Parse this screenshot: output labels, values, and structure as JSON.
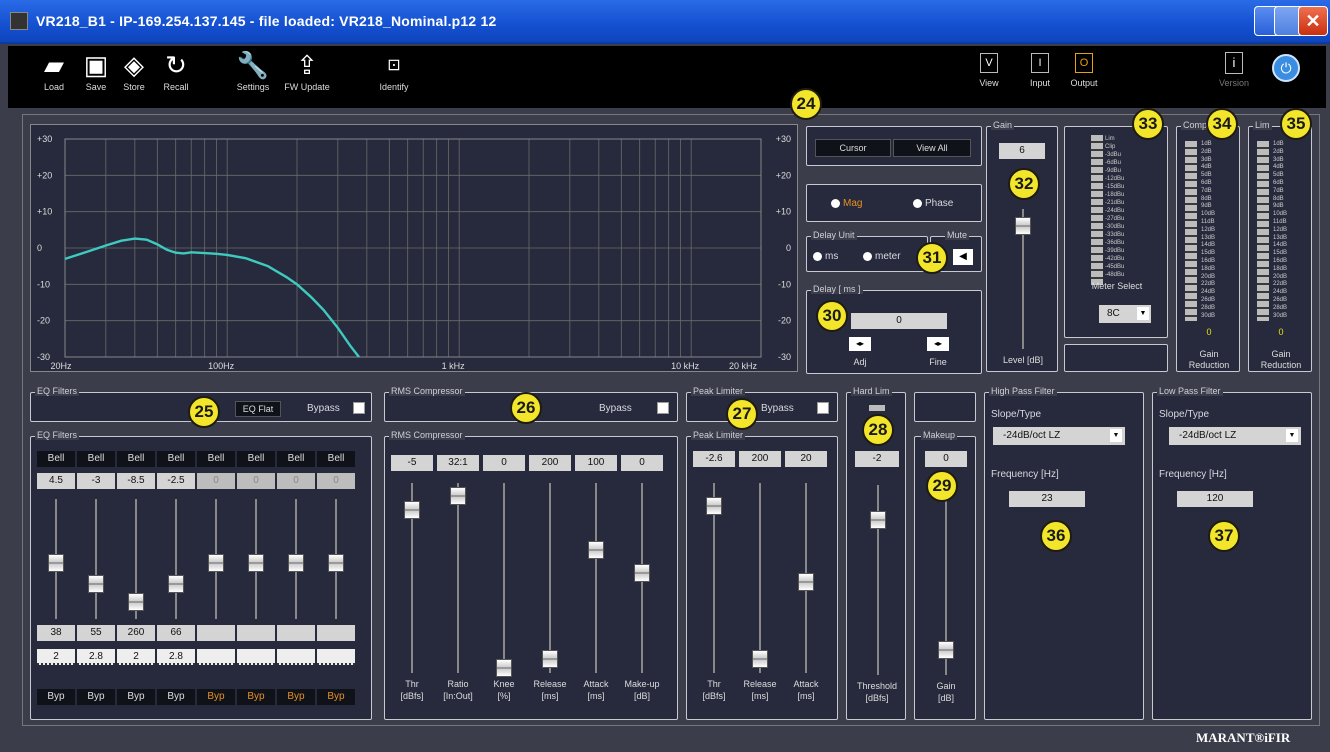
{
  "window": {
    "title": "VR218_B1 - IP-169.254.137.145 - file loaded: VR218_Nominal.p12 12"
  },
  "toolbar": {
    "left": [
      {
        "label": "Load",
        "icon": "folder-icon"
      },
      {
        "label": "Save",
        "icon": "floppy-icon"
      },
      {
        "label": "Store",
        "icon": "chip-icon"
      },
      {
        "label": "Recall",
        "icon": "refresh-icon"
      },
      {
        "label": "Settings",
        "icon": "wrench-icon"
      },
      {
        "label": "FW Update",
        "icon": "upload-icon"
      },
      {
        "label": "Identify",
        "icon": "magnifier-icon"
      }
    ],
    "view": {
      "label": "View",
      "value": "V"
    },
    "input": {
      "label": "Input",
      "value": "I"
    },
    "output": {
      "label": "Output",
      "value": "O"
    },
    "version": {
      "label": "Version",
      "value": "i"
    }
  },
  "plot": {
    "y_ticks": [
      "+30",
      "+20",
      "+10",
      "0",
      "-10",
      "-20",
      "-30"
    ],
    "x_ticks": [
      "20Hz",
      "100Hz",
      "1 kHz",
      "10 kHz",
      "20 kHz"
    ]
  },
  "cursor": {
    "cursor_label": "Cursor",
    "view_all_label": "View All"
  },
  "magphase": {
    "mag_label": "Mag",
    "phase_label": "Phase"
  },
  "delay_unit": {
    "title": "Delay Unit",
    "ms_label": "ms",
    "meter_label": "meter"
  },
  "mute": {
    "title": "Mute"
  },
  "delay": {
    "title": "Delay [ ms ]",
    "value": "0",
    "adj_label": "Adj",
    "fine_label": "Fine"
  },
  "gain": {
    "title": "Gain",
    "value": "6",
    "caption": "Level [dB]"
  },
  "meter": {
    "select_label": "Meter Select",
    "select_value": "8C",
    "labels": [
      "Lim",
      "Clip",
      "-3dBu",
      "-6dBu",
      "-9dBu",
      "-12dBu",
      "-15dBu",
      "-18dBu",
      "-21dBu",
      "-24dBu",
      "-27dBu",
      "-30dBu",
      "-33dBu",
      "-36dBu",
      "-39dBu",
      "-42dBu",
      "-45dBu",
      "-48dBu"
    ]
  },
  "comp_meter": {
    "title": "Comp",
    "value": "0",
    "caption1": "Gain",
    "caption2": "Reduction",
    "labels": [
      "1dB",
      "2dB",
      "3dB",
      "4dB",
      "5dB",
      "6dB",
      "7dB",
      "8dB",
      "9dB",
      "10dB",
      "11dB",
      "12dB",
      "13dB",
      "14dB",
      "15dB",
      "16dB",
      "18dB",
      "20dB",
      "22dB",
      "24dB",
      "26dB",
      "28dB",
      "30dB"
    ]
  },
  "lim_meter": {
    "title": "Lim",
    "value": "0",
    "caption1": "Gain",
    "caption2": "Reduction",
    "labels": [
      "1dB",
      "2dB",
      "3dB",
      "4dB",
      "5dB",
      "6dB",
      "7dB",
      "8dB",
      "9dB",
      "10dB",
      "11dB",
      "12dB",
      "13dB",
      "14dB",
      "15dB",
      "16dB",
      "18dB",
      "20dB",
      "22dB",
      "24dB",
      "26dB",
      "28dB",
      "30dB"
    ]
  },
  "eq_top": {
    "title": "EQ Filters",
    "flat_label": "EQ Flat",
    "bypass_label": "Bypass"
  },
  "rms_top": {
    "title": "RMS Compressor",
    "bypass_label": "Bypass"
  },
  "peak_top": {
    "title": "Peak Limiter",
    "bypass_label": "Bypass"
  },
  "hardlim": {
    "title": "Hard Lim",
    "value": "-2",
    "caption1": "Threshold",
    "caption2": "[dBfs]"
  },
  "eq": {
    "title": "EQ Filters",
    "types": [
      "Bell",
      "Bell",
      "Bell",
      "Bell",
      "Bell",
      "Bell",
      "Bell",
      "Bell"
    ],
    "gains": [
      "4.5",
      "-3",
      "-8.5",
      "-2.5",
      "0",
      "0",
      "0",
      "0"
    ],
    "freqs": [
      "38",
      "55",
      "260",
      "66",
      "",
      "",
      "",
      ""
    ],
    "qs": [
      "2",
      "2.8",
      "2",
      "2.8",
      "",
      "",
      "",
      ""
    ],
    "byp": [
      "Byp",
      "Byp",
      "Byp",
      "Byp",
      "Byp",
      "Byp",
      "Byp",
      "Byp"
    ],
    "byp_active": [
      false,
      false,
      false,
      false,
      true,
      true,
      true,
      true
    ],
    "knobs": [
      0.46,
      0.6,
      0.72,
      0.6,
      0.46,
      0.46,
      0.46,
      0.46
    ]
  },
  "rms": {
    "title": "RMS Compressor",
    "values": [
      "-5",
      "32:1",
      "0",
      "200",
      "100",
      "0"
    ],
    "captions": [
      [
        "Thr",
        "[dBfs]"
      ],
      [
        "Ratio",
        "[In:Out]"
      ],
      [
        "Knee",
        "[%]"
      ],
      [
        "Release",
        "[ms]"
      ],
      [
        "Attack",
        "[ms]"
      ],
      [
        "Make-up",
        "[dB]"
      ]
    ],
    "knobs": [
      0.1,
      0.02,
      0.98,
      0.93,
      0.32,
      0.45
    ]
  },
  "peak": {
    "title": "Peak Limiter",
    "values": [
      "-2.6",
      "200",
      "20"
    ],
    "captions": [
      [
        "Thr",
        "[dBfs]"
      ],
      [
        "Release",
        "[ms]"
      ],
      [
        "Attack",
        "[ms]"
      ]
    ],
    "knobs": [
      0.08,
      0.93,
      0.5
    ]
  },
  "makeup": {
    "title": "Makeup",
    "value": "0",
    "caption1": "Gain",
    "caption2": "[dB]"
  },
  "hpf": {
    "title": "High Pass Filter",
    "slope_label": "Slope/Type",
    "slope_value": "-24dB/oct LZ",
    "freq_label": "Frequency [Hz]",
    "freq_value": "23"
  },
  "lpf": {
    "title": "Low Pass Filter",
    "slope_label": "Slope/Type",
    "slope_value": "-24dB/oct LZ",
    "freq_label": "Frequency [Hz]",
    "freq_value": "120"
  },
  "callouts": [
    "24",
    "25",
    "26",
    "27",
    "28",
    "29",
    "30",
    "31",
    "32",
    "33",
    "34",
    "35",
    "36",
    "37"
  ],
  "brand": {
    "name": "MARANT®iFIR"
  },
  "colors": {
    "title_bar": "#1450d0",
    "panel": "#262a3c",
    "curve": "#3fcac0",
    "callout": "#f3e62a"
  }
}
